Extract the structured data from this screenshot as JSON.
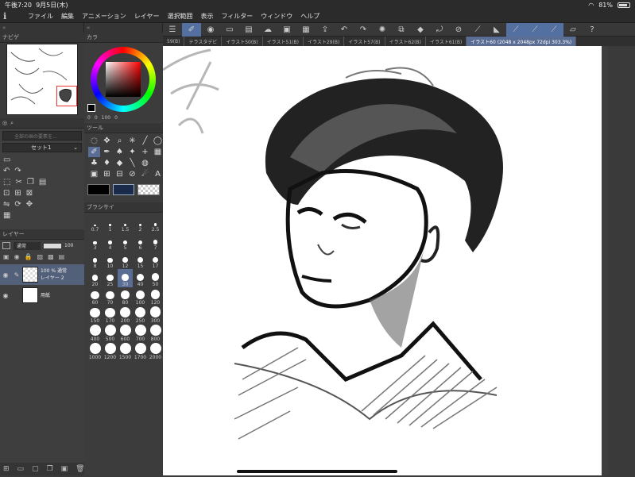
{
  "status": {
    "time": "午後7:20",
    "date": "9月5日(木)",
    "battery": "81%"
  },
  "menu": [
    "ファイル",
    "編集",
    "アニメーション",
    "レイヤー",
    "選択範囲",
    "表示",
    "フィルター",
    "ウィンドウ",
    "ヘルプ"
  ],
  "navigator": {
    "title": "ナビゲ",
    "zoom": "303.3"
  },
  "color": {
    "title": "カラ",
    "values": [
      "0",
      "0",
      "100",
      "0"
    ]
  },
  "subtool": {
    "set_label": "セット1",
    "search_placeholder": "全部の画の要素を..."
  },
  "tool": {
    "title": "ツール"
  },
  "brush_size": {
    "title": "ブラシサイ",
    "sizes": [
      "0.7",
      "1",
      "1.5",
      "2",
      "2.5",
      "3",
      "4",
      "5",
      "6",
      "7",
      "8",
      "10",
      "12",
      "15",
      "17",
      "20",
      "25",
      "30",
      "40",
      "50",
      "60",
      "70",
      "80",
      "100",
      "120",
      "150",
      "170",
      "200",
      "250",
      "300",
      "400",
      "500",
      "600",
      "700",
      "800",
      "1000",
      "1200",
      "1500",
      "1700",
      "2000"
    ],
    "selected": "30"
  },
  "layers": {
    "title": "レイヤー",
    "blend_mode": "通常",
    "opacity": "100",
    "items": [
      {
        "line1": "100 % 通常",
        "line2": "レイヤー 2"
      },
      {
        "line1": "",
        "line2": "用紙"
      }
    ]
  },
  "tabs": [
    "59(B)",
    "テラスタデビ",
    "イラスト50(B)",
    "イラスト51(B)",
    "イラスト29(B)",
    "イラスト57(B)",
    "イラスト62(B)",
    "イラスト61(B)",
    "イラスト60 (2048 x 2048px 72dpi 303.3%)"
  ],
  "toolbar_icons": [
    "menu-icon",
    "brush-icon",
    "eye-icon",
    "new-file-icon",
    "open-icon",
    "cloud-icon",
    "save-icon",
    "save-as-icon",
    "export-icon",
    "undo-icon",
    "redo-icon",
    "spinner-icon",
    "transform-icon",
    "fill-icon",
    "rotate-icon",
    "crop-icon",
    "stroke-icon",
    "stroke-icon",
    "stroke-icon",
    "ruler-icon",
    "help-icon"
  ]
}
